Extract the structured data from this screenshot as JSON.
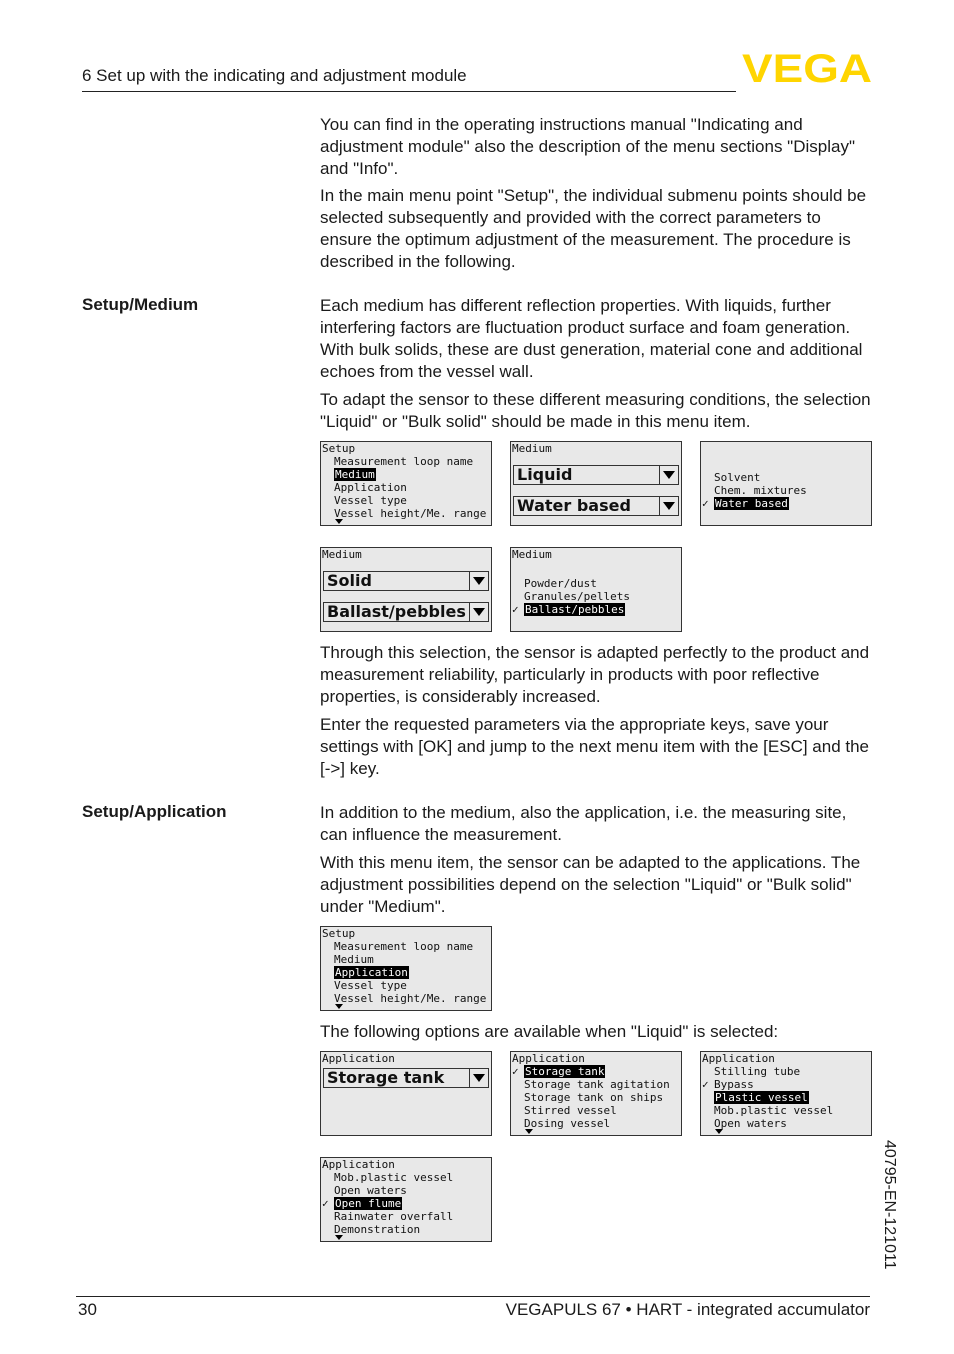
{
  "header": {
    "title": "6 Set up with the indicating and adjustment module",
    "logo": "VEGA",
    "logo_color": "#FFD500"
  },
  "intro": {
    "p1": "You can find in the operating instructions manual \"Indicating and adjustment module\" also the description of the menu sections \"Display\" and \"Info\".",
    "p2": "In the main menu point \"Setup\", the individual submenu points should be selected subsequently and provided with the correct parameters to ensure the optimum adjustment of the measurement. The procedure is described in the following."
  },
  "medium": {
    "side_label": "Setup/Medium",
    "p1": "Each medium has different reflection properties. With liquids, further interfering factors are fluctuation product surface and foam generation. With bulk solids, these are dust generation, material cone and additional echoes from the vessel wall.",
    "p2": "To adapt the sensor to these different measuring conditions, the selection \"Liquid\" or \"Bulk solid\" should be made in this menu item.",
    "p3": "Through this selection, the sensor is adapted perfectly to the product and measurement reliability, particularly in products with poor reflective properties, is considerably increased.",
    "p4": "Enter the requested parameters via the appropriate keys, save your settings with [OK] and jump to the next menu item with the [ESC] and the [->] key."
  },
  "application": {
    "side_label": "Setup/Application",
    "p1": "In addition to the medium, also the application, i.e. the measuring site, can influence the measurement.",
    "p2": "With this menu item, the sensor can be adapted to the applications. The adjustment possibilities depend on the selection \"Liquid\" or \"Bulk solid\" under \"Medium\".",
    "p3": "The following options are available when \"Liquid\" is selected:"
  },
  "screens": {
    "setup_medium": {
      "title": "Setup",
      "items": [
        "Measurement loop name",
        "Medium",
        "Application",
        "Vessel type",
        "Vessel height/Me. range"
      ],
      "selected": "Medium"
    },
    "medium_liquid": {
      "title": "Medium",
      "dd1": "Liquid",
      "dd2": "Water based"
    },
    "medium_list": {
      "items": [
        "Solvent",
        "Chem. mixtures",
        "Water based"
      ],
      "selected": "Water based"
    },
    "medium_solid": {
      "title": "Medium",
      "dd1": "Solid",
      "dd2": "Ballast/pebbles"
    },
    "medium_solid_list": {
      "title": "Medium",
      "items": [
        "Powder/dust",
        "Granules/pellets",
        "Ballast/pebbles"
      ],
      "selected": "Ballast/pebbles"
    },
    "setup_app": {
      "title": "Setup",
      "items": [
        "Measurement loop name",
        "Medium",
        "Application",
        "Vessel type",
        "Vessel height/Me. range"
      ],
      "selected": "Application"
    },
    "app_dd": {
      "title": "Application",
      "dd1": "Storage tank"
    },
    "app_list1": {
      "title": "Application",
      "items": [
        "Storage tank",
        "Storage tank agitation",
        "Storage tank on ships",
        "Stirred vessel",
        "Dosing vessel"
      ]
    },
    "app_list2": {
      "title": "Application",
      "items": [
        "Stilling tube",
        "Bypass",
        "Plastic vessel",
        "Mob.plastic vessel",
        "Open waters"
      ]
    },
    "app_list3": {
      "title": "Application",
      "items": [
        "Mob.plastic vessel",
        "Open waters",
        "Open flume",
        "Rainwater overfall",
        "Demonstration"
      ]
    }
  },
  "footer": {
    "page": "30",
    "product": "VEGAPULS 67 • HART - integrated accumulator",
    "docnum": "40795-EN-121011"
  }
}
